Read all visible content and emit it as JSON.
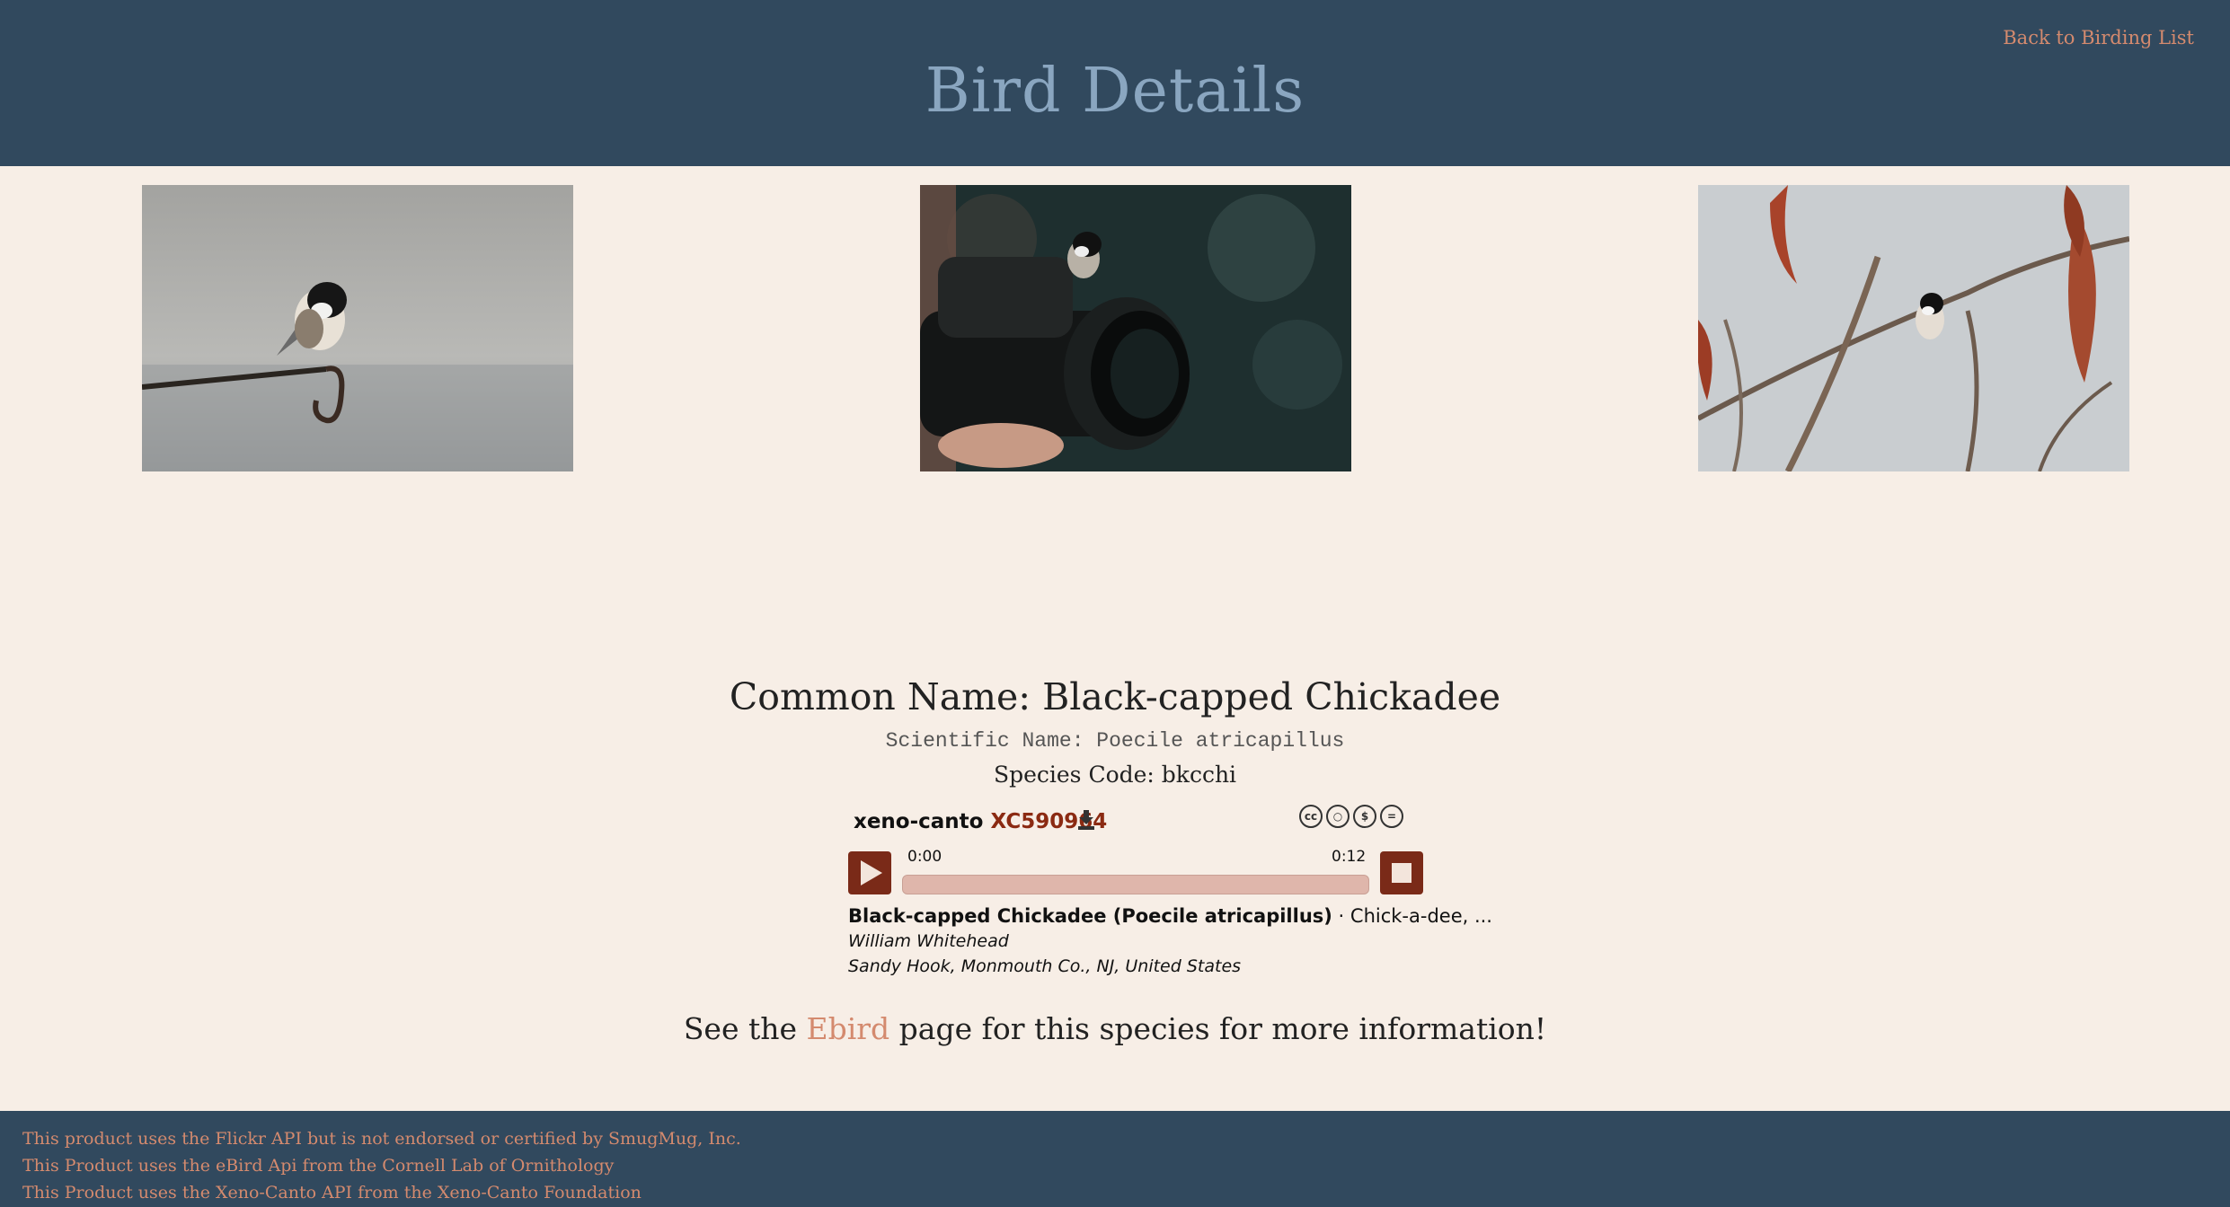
{
  "header": {
    "title": "Bird Details",
    "back_link": "Back to Birding List"
  },
  "photos": [
    {
      "name": "chickadee-on-hook-photo"
    },
    {
      "name": "chickadee-on-camera-lens-photo"
    },
    {
      "name": "chickadee-on-branch-photo"
    }
  ],
  "species": {
    "common_name": "Common Name: Black-capped Chickadee",
    "scientific_name": "Scientific Name: Poecile atricapillus",
    "species_code": "Species Code: bkcchi"
  },
  "player": {
    "brand": "xeno-canto",
    "recording_id": "XC590964",
    "license_icons": [
      "cc",
      "by",
      "nc",
      "nd"
    ],
    "time_start": "0:00",
    "time_end": "0:12",
    "progress": 0,
    "title_bold": "Black-capped Chickadee (Poecile atricapillus)",
    "title_rest": " · Chick-a-dee, ...",
    "recordist": "William Whitehead",
    "location": "Sandy Hook, Monmouth Co., NJ, United States"
  },
  "more_info": {
    "prefix": "See the ",
    "link": "Ebird",
    "suffix": " page for this species for more information!"
  },
  "footer": {
    "lines": [
      "This product uses the Flickr API but is not endorsed or certified by SmugMug, Inc.",
      "This Product uses the eBird Api from the Cornell Lab of Ornithology",
      "This Product uses the Xeno-Canto API from the Xeno-Canto Foundation"
    ]
  }
}
